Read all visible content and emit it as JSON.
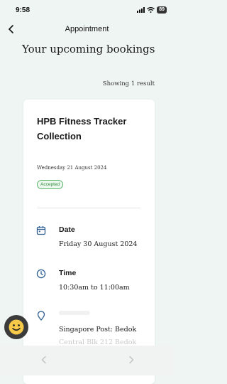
{
  "status_bar": {
    "time": "9:58",
    "battery": "89"
  },
  "nav": {
    "title": "Appointment"
  },
  "heading": "Your upcoming bookings",
  "result_count": "Showing 1 result",
  "booking": {
    "title": "HPB Fitness Tracker Collection",
    "booked_date": "Wednesday 21 August 2024",
    "status": "Accepted",
    "date_label": "Date",
    "date_value": "Friday 30 August 2024",
    "time_label": "Time",
    "time_value": "10:30am to 11:00am",
    "location_value": "Singapore Post: Bedok",
    "location_value_2": "Central Blk 212 Bedok"
  },
  "colors": {
    "accent": "#2d5e8f",
    "badge_green": "#2e8b3c",
    "background": "#eef5f2"
  },
  "icons": [
    "back-icon",
    "calendar-icon",
    "clock-icon",
    "location-pin-icon",
    "smiley-icon",
    "chevron-left-icon",
    "chevron-right-icon"
  ]
}
